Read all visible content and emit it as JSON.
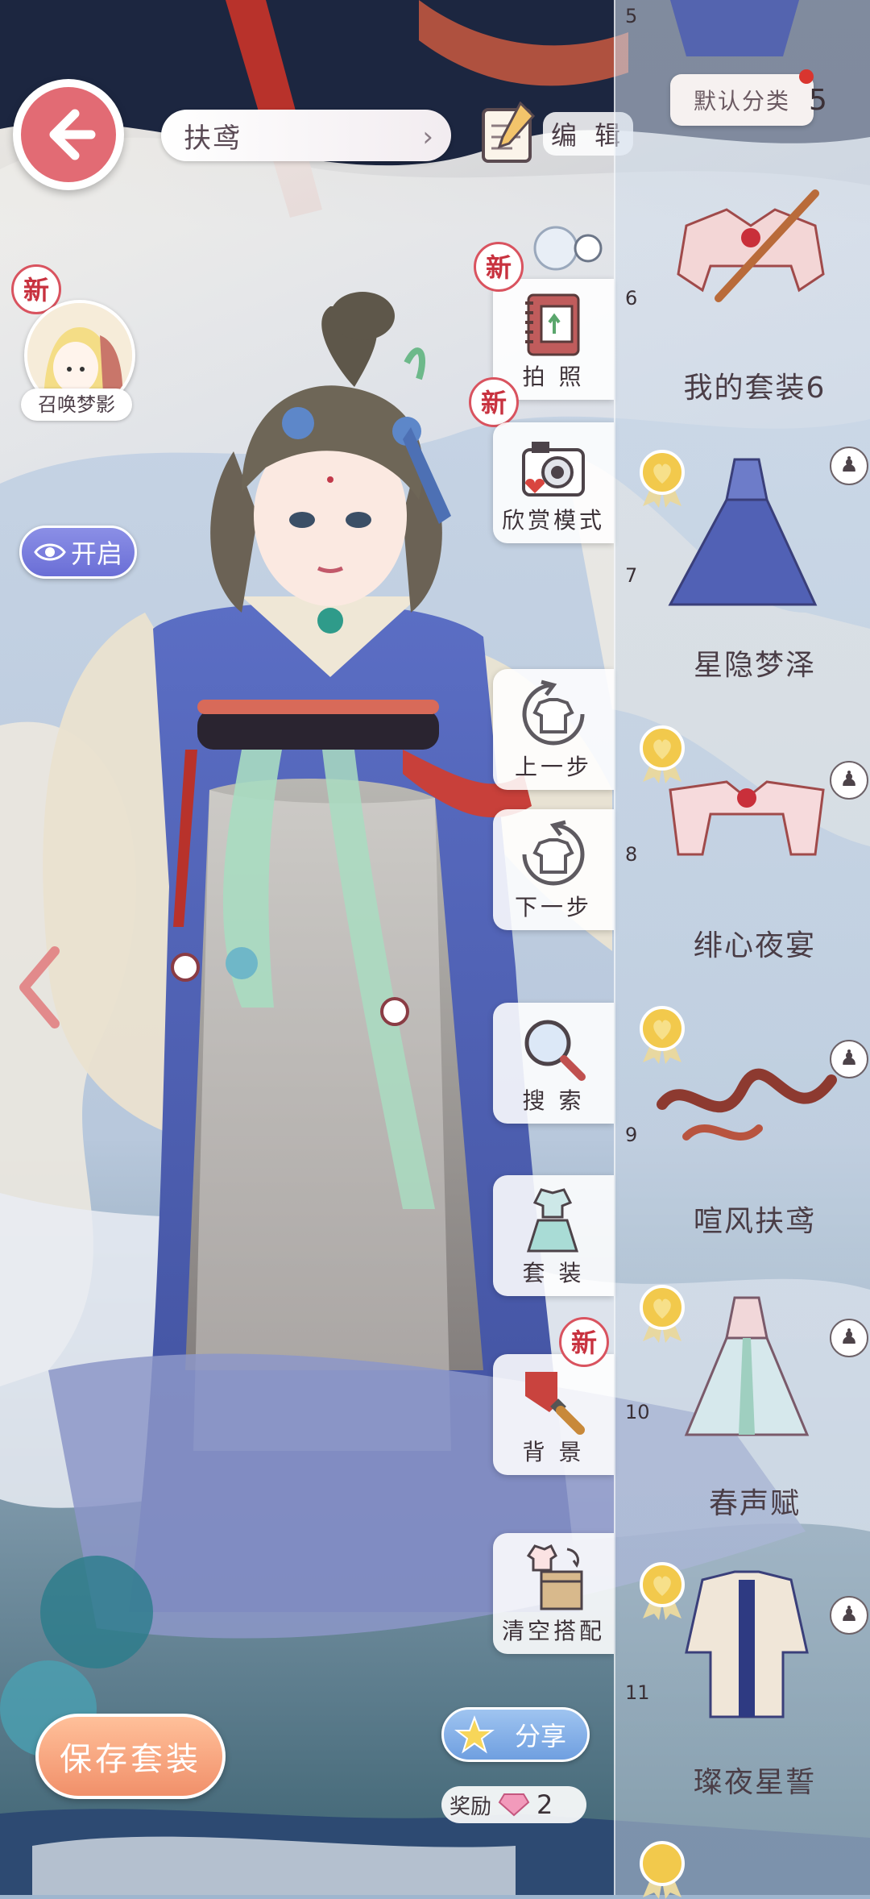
{
  "header": {
    "outfit_name": "扶鸢",
    "edit_label": "编 辑"
  },
  "left_panel": {
    "new_badge": "新",
    "summon_label": "召唤梦影",
    "toggle_label": "开启"
  },
  "tools": [
    {
      "label": "拍 照",
      "new": "新",
      "icon": "photo-album-icon"
    },
    {
      "label": "欣赏模式",
      "icon": "camera-icon"
    },
    {
      "label": "上一步",
      "icon": "undo-shirt-icon"
    },
    {
      "label": "下一步",
      "icon": "redo-shirt-icon"
    },
    {
      "label": "搜 索",
      "icon": "magnifier-icon"
    },
    {
      "label": "套 装",
      "icon": "outfit-icon"
    },
    {
      "label": "背 景",
      "new": "新",
      "icon": "paint-brush-icon"
    },
    {
      "label": "清空搭配",
      "icon": "clear-box-icon"
    }
  ],
  "list_panel": {
    "category_label": "默认分类",
    "category_count": "5",
    "top_index": "5",
    "items": [
      {
        "index": "6",
        "name": "我的套装6"
      },
      {
        "index": "7",
        "name": "星隐梦泽"
      },
      {
        "index": "8",
        "name": "绯心夜宴"
      },
      {
        "index": "9",
        "name": "喧风扶鸢"
      },
      {
        "index": "10",
        "name": "春声赋"
      },
      {
        "index": "11",
        "name": "璨夜星誓"
      }
    ]
  },
  "bottom": {
    "save_label": "保存套装",
    "share_label": "分享",
    "reward_label": "奖励",
    "reward_count": "2"
  },
  "colors": {
    "accent_red": "#e26b74",
    "save_orange": "#f1906a",
    "share_blue": "#6f9fe0",
    "toggle_purple": "#6a6ed6",
    "medal_gold": "#f2c94c"
  }
}
